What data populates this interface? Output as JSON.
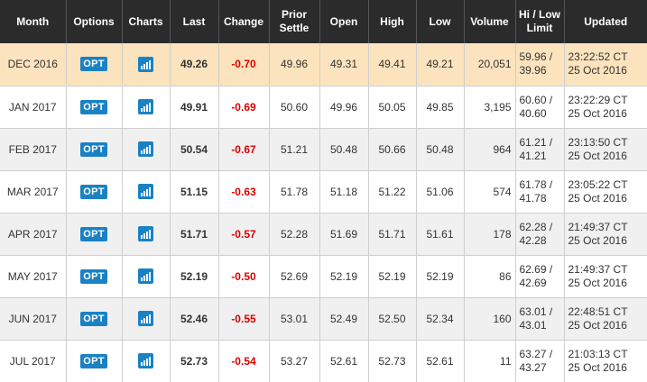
{
  "headers": {
    "month": "Month",
    "options": "Options",
    "charts": "Charts",
    "last": "Last",
    "change": "Change",
    "prior_settle_1": "Prior",
    "prior_settle_2": "Settle",
    "open": "Open",
    "high": "High",
    "low": "Low",
    "volume": "Volume",
    "limit_1": "Hi / Low",
    "limit_2": "Limit",
    "updated": "Updated"
  },
  "opt_label": "OPT",
  "chart_icon": "bar-chart-icon",
  "colors": {
    "header_bg": "#2b2b2b",
    "highlight_row": "#fbe3bd",
    "alt_row": "#f0f0f0",
    "button_blue": "#1a82c4",
    "negative_change": "#dd0000"
  },
  "rows": [
    {
      "month": "DEC 2016",
      "last": "49.26",
      "change": "-0.70",
      "prior_settle": "49.96",
      "open": "49.31",
      "high": "49.41",
      "low": "49.21",
      "volume": "20,051",
      "limit_hi": "59.96 /",
      "limit_lo": "39.96",
      "updated_time": "23:22:52 CT",
      "updated_date": "25 Oct 2016"
    },
    {
      "month": "JAN 2017",
      "last": "49.91",
      "change": "-0.69",
      "prior_settle": "50.60",
      "open": "49.96",
      "high": "50.05",
      "low": "49.85",
      "volume": "3,195",
      "limit_hi": "60.60 /",
      "limit_lo": "40.60",
      "updated_time": "23:22:29 CT",
      "updated_date": "25 Oct 2016"
    },
    {
      "month": "FEB 2017",
      "last": "50.54",
      "change": "-0.67",
      "prior_settle": "51.21",
      "open": "50.48",
      "high": "50.66",
      "low": "50.48",
      "volume": "964",
      "limit_hi": "61.21 /",
      "limit_lo": "41.21",
      "updated_time": "23:13:50 CT",
      "updated_date": "25 Oct 2016"
    },
    {
      "month": "MAR 2017",
      "last": "51.15",
      "change": "-0.63",
      "prior_settle": "51.78",
      "open": "51.18",
      "high": "51.22",
      "low": "51.06",
      "volume": "574",
      "limit_hi": "61.78 /",
      "limit_lo": "41.78",
      "updated_time": "23:05:22 CT",
      "updated_date": "25 Oct 2016"
    },
    {
      "month": "APR 2017",
      "last": "51.71",
      "change": "-0.57",
      "prior_settle": "52.28",
      "open": "51.69",
      "high": "51.71",
      "low": "51.61",
      "volume": "178",
      "limit_hi": "62.28 /",
      "limit_lo": "42.28",
      "updated_time": "21:49:37 CT",
      "updated_date": "25 Oct 2016"
    },
    {
      "month": "MAY 2017",
      "last": "52.19",
      "change": "-0.50",
      "prior_settle": "52.69",
      "open": "52.19",
      "high": "52.19",
      "low": "52.19",
      "volume": "86",
      "limit_hi": "62.69 /",
      "limit_lo": "42.69",
      "updated_time": "21:49:37 CT",
      "updated_date": "25 Oct 2016"
    },
    {
      "month": "JUN 2017",
      "last": "52.46",
      "change": "-0.55",
      "prior_settle": "53.01",
      "open": "52.49",
      "high": "52.50",
      "low": "52.34",
      "volume": "160",
      "limit_hi": "63.01 /",
      "limit_lo": "43.01",
      "updated_time": "22:48:51 CT",
      "updated_date": "25 Oct 2016"
    },
    {
      "month": "JUL 2017",
      "last": "52.73",
      "change": "-0.54",
      "prior_settle": "53.27",
      "open": "52.61",
      "high": "52.73",
      "low": "52.61",
      "volume": "11",
      "limit_hi": "63.27 /",
      "limit_lo": "43.27",
      "updated_time": "21:03:13 CT",
      "updated_date": "25 Oct 2016"
    }
  ]
}
